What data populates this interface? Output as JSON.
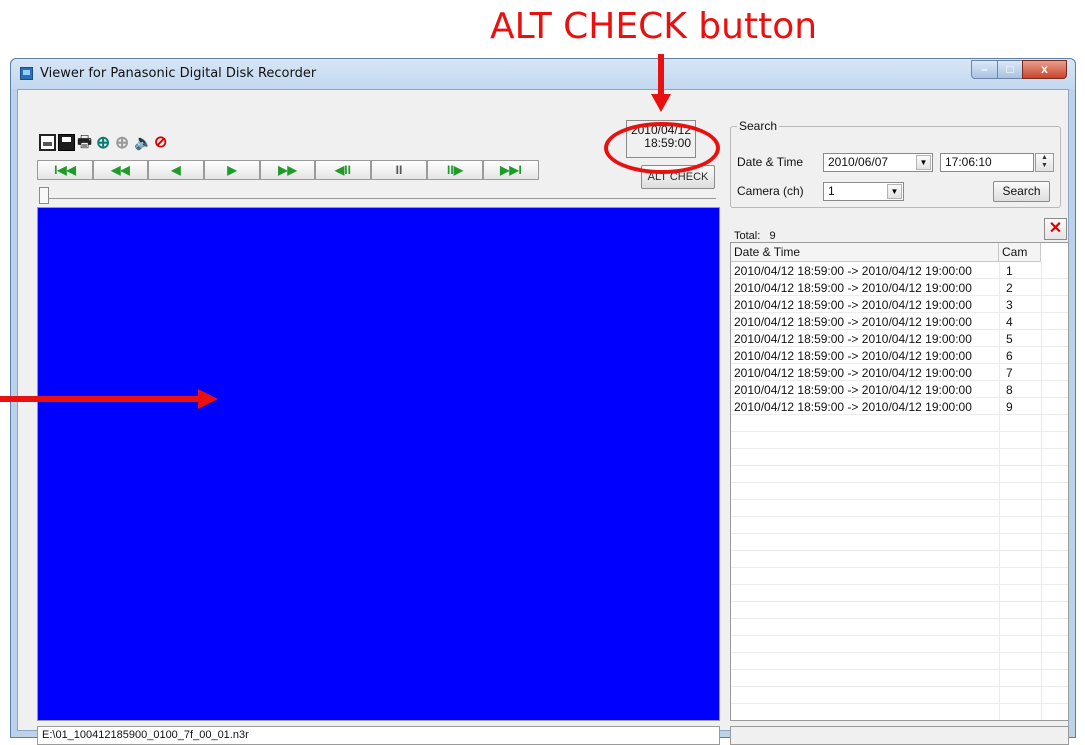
{
  "annotation": {
    "title": "ALT CHECK button",
    "color": "#e8110f"
  },
  "window": {
    "title": "Viewer for Panasonic Digital Disk Recorder",
    "controls": {
      "minimize": "–",
      "maximize": "□",
      "close": "x"
    }
  },
  "toolbar": {
    "icons": [
      "open-icon",
      "save-icon",
      "print-icon",
      "zoom-in-icon",
      "zoom-icon",
      "audio-icon",
      "stop-icon"
    ]
  },
  "playback": {
    "first": "I◀◀",
    "rewind": "◀◀",
    "back": "◀",
    "play": "▶",
    "fast_forward": "▶▶",
    "frame_back": "◀II",
    "pause": "II",
    "frame_forward": "II▶",
    "last": "▶▶I"
  },
  "timestamp": {
    "date": "2010/04/12",
    "time": "18:59:00"
  },
  "alt_check": {
    "label": "ALT CHECK"
  },
  "file_path": "E:\\01_100412185900_0100_7f_00_01.n3r",
  "search": {
    "legend": "Search",
    "date_time_label": "Date & Time",
    "date_value": "2010/06/07",
    "time_value": "17:06:10",
    "camera_label": "Camera (ch)",
    "camera_value": "1",
    "button": "Search"
  },
  "results": {
    "total_label": "Total:",
    "total_value": "9",
    "columns": {
      "date_time": "Date & Time",
      "cam": "Cam"
    },
    "rows": [
      {
        "date_time": "2010/04/12 18:59:00 -> 2010/04/12 19:00:00",
        "cam": "1"
      },
      {
        "date_time": "2010/04/12 18:59:00 -> 2010/04/12 19:00:00",
        "cam": "2"
      },
      {
        "date_time": "2010/04/12 18:59:00 -> 2010/04/12 19:00:00",
        "cam": "3"
      },
      {
        "date_time": "2010/04/12 18:59:00 -> 2010/04/12 19:00:00",
        "cam": "4"
      },
      {
        "date_time": "2010/04/12 18:59:00 -> 2010/04/12 19:00:00",
        "cam": "5"
      },
      {
        "date_time": "2010/04/12 18:59:00 -> 2010/04/12 19:00:00",
        "cam": "6"
      },
      {
        "date_time": "2010/04/12 18:59:00 -> 2010/04/12 19:00:00",
        "cam": "7"
      },
      {
        "date_time": "2010/04/12 18:59:00 -> 2010/04/12 19:00:00",
        "cam": "8"
      },
      {
        "date_time": "2010/04/12 18:59:00 -> 2010/04/12 19:00:00",
        "cam": "9"
      }
    ]
  },
  "colors": {
    "video_background": "#0000ff",
    "play_button_accent": "#1f9b2a"
  }
}
